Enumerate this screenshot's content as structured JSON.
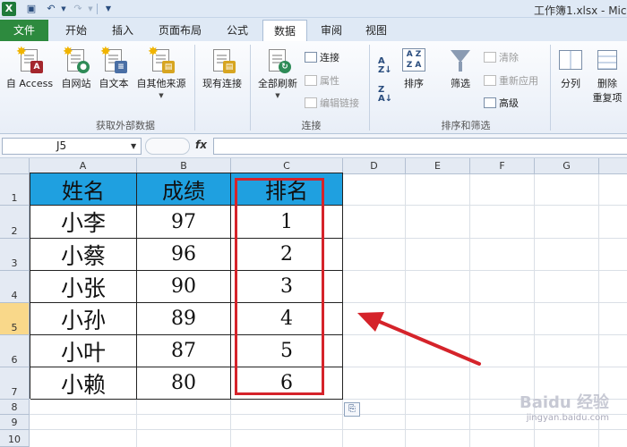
{
  "window": {
    "title": "工作簿1.xlsx - Mic"
  },
  "tabs": [
    {
      "label": "文件",
      "active": false
    },
    {
      "label": "开始",
      "active": false
    },
    {
      "label": "插入",
      "active": false
    },
    {
      "label": "页面布局",
      "active": false
    },
    {
      "label": "公式",
      "active": false
    },
    {
      "label": "数据",
      "active": true
    },
    {
      "label": "审阅",
      "active": false
    },
    {
      "label": "视图",
      "active": false
    }
  ],
  "ribbon": {
    "group_external": {
      "label": "获取外部数据",
      "buttons": [
        "自 Access",
        "自网站",
        "自文本",
        "自其他来源",
        "现有连接"
      ]
    },
    "group_connect": {
      "label": "连接",
      "refresh_all": "全部刷新",
      "connections": "连接",
      "properties": "属性",
      "edit_links": "编辑链接"
    },
    "group_sort": {
      "label": "排序和筛选",
      "sort": "排序",
      "filter": "筛选",
      "clear": "清除",
      "reapply": "重新应用",
      "advanced": "高级"
    },
    "group_tools": {
      "text_to_columns": "分列",
      "remove_duplicates_line1": "删除",
      "remove_duplicates_line2": "重复项"
    }
  },
  "formula_bar": {
    "name_box": "J5",
    "fx": "fx",
    "value": ""
  },
  "grid": {
    "columns": [
      "A",
      "B",
      "C",
      "D",
      "E",
      "F",
      "G"
    ],
    "rows": [
      "1",
      "2",
      "3",
      "4",
      "5",
      "6",
      "7",
      "8",
      "9",
      "10"
    ],
    "selected_row": "5",
    "table": {
      "headers": [
        "姓名",
        "成绩",
        "排名"
      ],
      "rows": [
        [
          "小李",
          "97",
          "1"
        ],
        [
          "小蔡",
          "96",
          "2"
        ],
        [
          "小张",
          "90",
          "3"
        ],
        [
          "小孙",
          "89",
          "4"
        ],
        [
          "小叶",
          "87",
          "5"
        ],
        [
          "小赖",
          "80",
          "6"
        ]
      ]
    }
  },
  "colors": {
    "header_fill": "#1fa0e0",
    "highlight": "#d5232a",
    "file_tab": "#2d8a3e"
  },
  "watermark": {
    "logo": "Baidu 经验",
    "url": "jingyan.baidu.com"
  }
}
